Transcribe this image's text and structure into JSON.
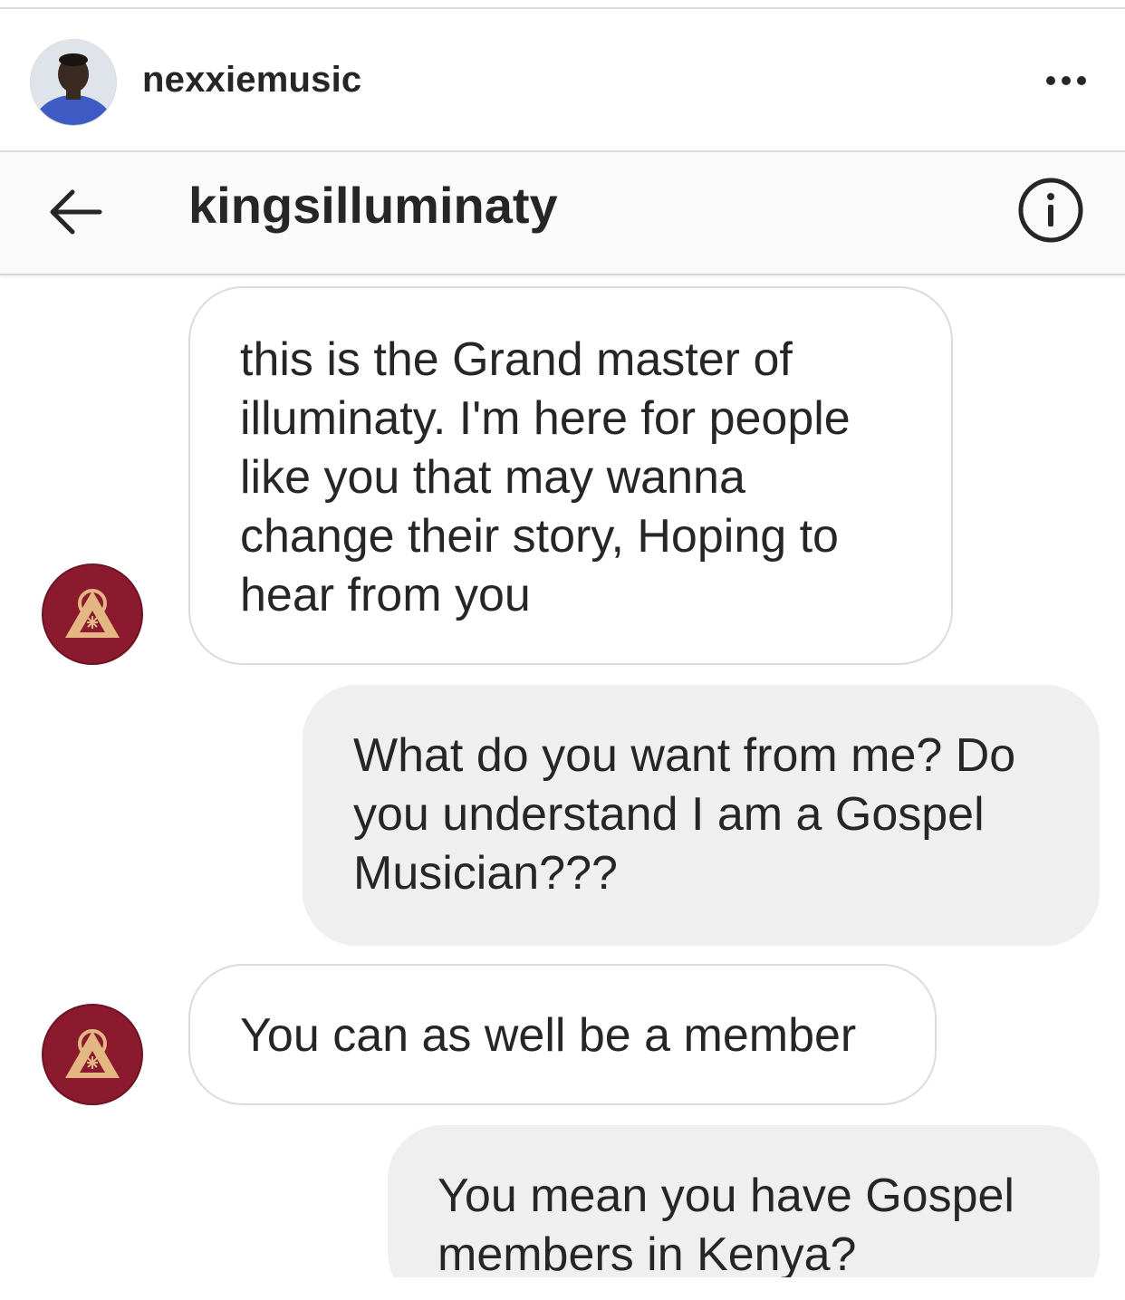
{
  "post": {
    "username": "nexxiemusic",
    "avatar_icon": "profile-photo",
    "more_icon": "more-dots-icon"
  },
  "dm_header": {
    "back_icon": "back-arrow-icon",
    "title": "kingsilluminaty",
    "info_icon": "info-icon"
  },
  "messages": [
    {
      "from": "kingsilluminaty",
      "direction": "incoming",
      "text": "this is the Grand master of\nilluminaty. I'm here for people\nlike you that may wanna\nchange their story, Hoping to\nhear from you"
    },
    {
      "from": "me",
      "direction": "outgoing",
      "text": "What do you want from me? Do\nyou understand I am a Gospel\nMusician???"
    },
    {
      "from": "kingsilluminaty",
      "direction": "incoming",
      "text": "You can as well be a member"
    },
    {
      "from": "me",
      "direction": "outgoing",
      "text": "You mean you have Gospel\nmembers in Kenya?"
    }
  ],
  "colors": {
    "incoming_bubble": "#ffffff",
    "outgoing_bubble": "#efefef",
    "avatar_badge": "#8c1a2e",
    "badge_gold": "#e3b684",
    "text": "#262626"
  }
}
